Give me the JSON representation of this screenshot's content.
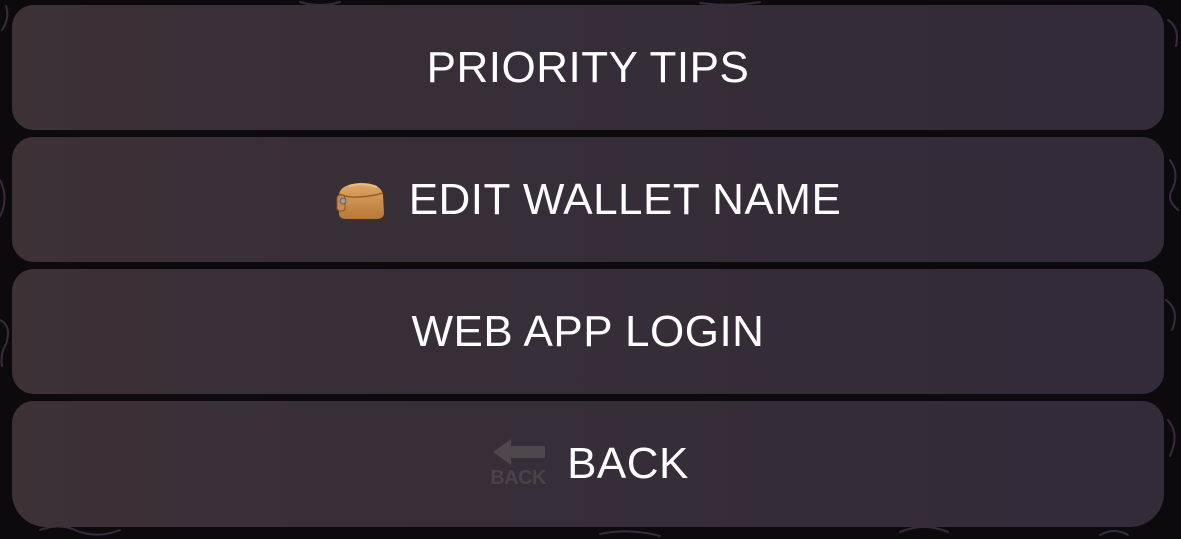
{
  "keyboard": {
    "buttons": [
      {
        "label": "PRIORITY TIPS",
        "icon": ""
      },
      {
        "label": "EDIT WALLET NAME",
        "icon": "purse-emoji-icon"
      },
      {
        "label": "WEB APP LOGIN",
        "icon": ""
      },
      {
        "label": "BACK",
        "icon": "back-arrow-emoji-icon",
        "icon_text": "BACK"
      }
    ]
  },
  "colors": {
    "button_bg": "#382e38",
    "text": "#ffffff",
    "background": "#0d0a0e"
  }
}
